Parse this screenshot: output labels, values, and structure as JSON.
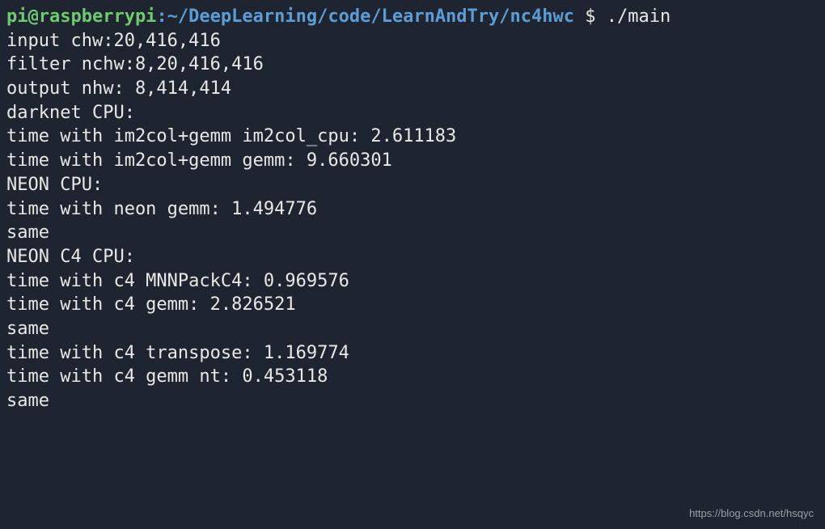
{
  "prompt": {
    "user": "pi@raspberrypi",
    "separator": ":",
    "path": "~/DeepLearning/code/LearnAndTry/nc4hwc ",
    "symbol": "$ ",
    "command": "./main"
  },
  "output": {
    "lines": [
      "input chw:20,416,416",
      "filter nchw:8,20,416,416",
      "output nhw: 8,414,414",
      "",
      "darknet CPU:",
      "time with im2col+gemm im2col_cpu: 2.611183",
      "time with im2col+gemm gemm: 9.660301",
      "",
      "NEON CPU:",
      "time with neon gemm: 1.494776",
      "same",
      "",
      "NEON C4 CPU:",
      "time with c4 MNNPackC4: 0.969576",
      "time with c4 gemm: 2.826521",
      "same",
      "time with c4 transpose: 1.169774",
      "time with c4 gemm nt: 0.453118",
      "same"
    ]
  },
  "watermark": "https://blog.csdn.net/hsqyc"
}
